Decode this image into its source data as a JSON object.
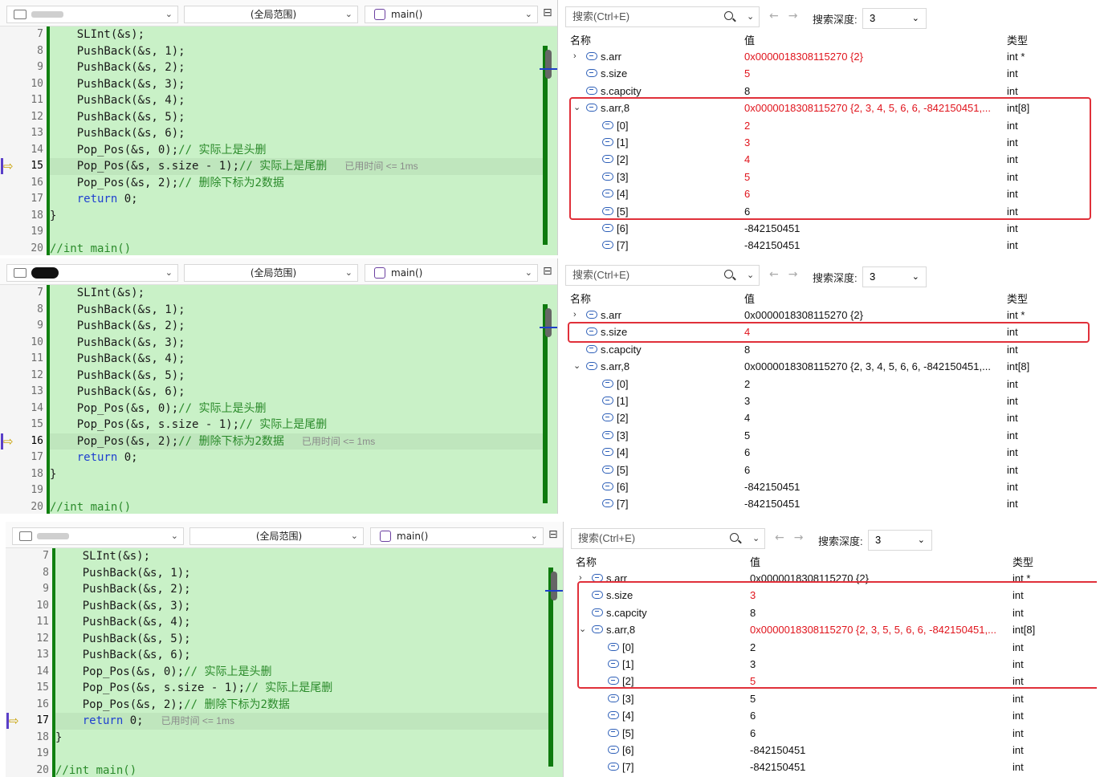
{
  "panels": [
    {
      "editor": {
        "project_selector": "",
        "scope_selector": "(全局范围)",
        "function_selector": "main()",
        "current_line": 15,
        "elapsed": "已用时间 <= 1ms",
        "lines": [
          {
            "num": "7",
            "code": "    SLInt(&s);"
          },
          {
            "num": "8",
            "code": "    PushBack(&s, 1);"
          },
          {
            "num": "9",
            "code": "    PushBack(&s, 2);"
          },
          {
            "num": "10",
            "code": "    PushBack(&s, 3);"
          },
          {
            "num": "11",
            "code": "    PushBack(&s, 4);"
          },
          {
            "num": "12",
            "code": "    PushBack(&s, 5);"
          },
          {
            "num": "13",
            "code": "    PushBack(&s, 6);"
          },
          {
            "num": "14",
            "code": "    Pop_Pos(&s, 0);",
            "comment": "// 实际上是头删"
          },
          {
            "num": "15",
            "code": "    Pop_Pos(&s, s.size - 1);",
            "comment": "// 实际上是尾删"
          },
          {
            "num": "16",
            "code": "    Pop_Pos(&s, 2);",
            "comment": "// 删除下标为2数据"
          },
          {
            "num": "17",
            "code": "    ",
            "keyword": "return",
            "after": " 0;"
          },
          {
            "num": "18",
            "code": "}"
          },
          {
            "num": "19",
            "code": ""
          },
          {
            "num": "20",
            "code": "",
            "comment": "//int main()"
          }
        ]
      },
      "watch": {
        "search_placeholder": "搜索(Ctrl+E)",
        "depth_label": "搜索深度:",
        "depth_value": "3",
        "col_name": "名称",
        "col_value": "值",
        "col_type": "类型",
        "rows": [
          {
            "name": "s.arr",
            "value": "0x0000018308115270 {2}",
            "type": "int *",
            "expander": "›",
            "indent": 0,
            "red": true
          },
          {
            "name": "s.size",
            "value": "5",
            "type": "int",
            "indent": 0,
            "red": true
          },
          {
            "name": "s.capcity",
            "value": "8",
            "type": "int",
            "indent": 0
          },
          {
            "name": "s.arr,8",
            "value": "0x0000018308115270 {2, 3, 4, 5, 6, 6, -842150451,...",
            "type": "int[8]",
            "expander": "⌄",
            "indent": 0,
            "red": true
          },
          {
            "name": "[0]",
            "value": "2",
            "type": "int",
            "indent": 1,
            "red": true
          },
          {
            "name": "[1]",
            "value": "3",
            "type": "int",
            "indent": 1,
            "red": true
          },
          {
            "name": "[2]",
            "value": "4",
            "type": "int",
            "indent": 1,
            "red": true
          },
          {
            "name": "[3]",
            "value": "5",
            "type": "int",
            "indent": 1,
            "red": true
          },
          {
            "name": "[4]",
            "value": "6",
            "type": "int",
            "indent": 1,
            "red": true
          },
          {
            "name": "[5]",
            "value": "6",
            "type": "int",
            "indent": 1
          },
          {
            "name": "[6]",
            "value": "-842150451",
            "type": "int",
            "indent": 1
          },
          {
            "name": "[7]",
            "value": "-842150451",
            "type": "int",
            "indent": 1
          }
        ]
      }
    },
    {
      "editor": {
        "project_selector": "",
        "scope_selector": "(全局范围)",
        "function_selector": "main()",
        "current_line": 16,
        "elapsed": "已用时间 <= 1ms",
        "lines": [
          {
            "num": "7",
            "code": "    SLInt(&s);"
          },
          {
            "num": "8",
            "code": "    PushBack(&s, 1);"
          },
          {
            "num": "9",
            "code": "    PushBack(&s, 2);"
          },
          {
            "num": "10",
            "code": "    PushBack(&s, 3);"
          },
          {
            "num": "11",
            "code": "    PushBack(&s, 4);"
          },
          {
            "num": "12",
            "code": "    PushBack(&s, 5);"
          },
          {
            "num": "13",
            "code": "    PushBack(&s, 6);"
          },
          {
            "num": "14",
            "code": "    Pop_Pos(&s, 0);",
            "comment": "// 实际上是头删"
          },
          {
            "num": "15",
            "code": "    Pop_Pos(&s, s.size - 1);",
            "comment": "// 实际上是尾删"
          },
          {
            "num": "16",
            "code": "    Pop_Pos(&s, 2);",
            "comment": "// 删除下标为2数据"
          },
          {
            "num": "17",
            "code": "    ",
            "keyword": "return",
            "after": " 0;"
          },
          {
            "num": "18",
            "code": "}"
          },
          {
            "num": "19",
            "code": ""
          },
          {
            "num": "20",
            "code": "",
            "comment": "//int main()"
          }
        ]
      },
      "watch": {
        "search_placeholder": "搜索(Ctrl+E)",
        "depth_label": "搜索深度:",
        "depth_value": "3",
        "col_name": "名称",
        "col_value": "值",
        "col_type": "类型",
        "rows": [
          {
            "name": "s.arr",
            "value": "0x0000018308115270 {2}",
            "type": "int *",
            "expander": "›",
            "indent": 0
          },
          {
            "name": "s.size",
            "value": "4",
            "type": "int",
            "indent": 0,
            "red": true
          },
          {
            "name": "s.capcity",
            "value": "8",
            "type": "int",
            "indent": 0
          },
          {
            "name": "s.arr,8",
            "value": "0x0000018308115270 {2, 3, 4, 5, 6, 6, -842150451,...",
            "type": "int[8]",
            "expander": "⌄",
            "indent": 0
          },
          {
            "name": "[0]",
            "value": "2",
            "type": "int",
            "indent": 1
          },
          {
            "name": "[1]",
            "value": "3",
            "type": "int",
            "indent": 1
          },
          {
            "name": "[2]",
            "value": "4",
            "type": "int",
            "indent": 1
          },
          {
            "name": "[3]",
            "value": "5",
            "type": "int",
            "indent": 1
          },
          {
            "name": "[4]",
            "value": "6",
            "type": "int",
            "indent": 1
          },
          {
            "name": "[5]",
            "value": "6",
            "type": "int",
            "indent": 1
          },
          {
            "name": "[6]",
            "value": "-842150451",
            "type": "int",
            "indent": 1
          },
          {
            "name": "[7]",
            "value": "-842150451",
            "type": "int",
            "indent": 1
          }
        ]
      }
    },
    {
      "editor": {
        "project_selector": "",
        "scope_selector": "(全局范围)",
        "function_selector": "main()",
        "current_line": 17,
        "elapsed": "已用时间 <= 1ms",
        "lines": [
          {
            "num": "7",
            "code": "    SLInt(&s);"
          },
          {
            "num": "8",
            "code": "    PushBack(&s, 1);"
          },
          {
            "num": "9",
            "code": "    PushBack(&s, 2);"
          },
          {
            "num": "10",
            "code": "    PushBack(&s, 3);"
          },
          {
            "num": "11",
            "code": "    PushBack(&s, 4);"
          },
          {
            "num": "12",
            "code": "    PushBack(&s, 5);"
          },
          {
            "num": "13",
            "code": "    PushBack(&s, 6);"
          },
          {
            "num": "14",
            "code": "    Pop_Pos(&s, 0);",
            "comment": "// 实际上是头删"
          },
          {
            "num": "15",
            "code": "    Pop_Pos(&s, s.size - 1);",
            "comment": "// 实际上是尾删"
          },
          {
            "num": "16",
            "code": "    Pop_Pos(&s, 2);",
            "comment": "// 删除下标为2数据"
          },
          {
            "num": "17",
            "code": "    ",
            "keyword": "return",
            "after": " 0;"
          },
          {
            "num": "18",
            "code": "}"
          },
          {
            "num": "19",
            "code": ""
          },
          {
            "num": "20",
            "code": "",
            "comment": "//int main()"
          }
        ]
      },
      "watch": {
        "search_placeholder": "搜索(Ctrl+E)",
        "depth_label": "搜索深度:",
        "depth_value": "3",
        "col_name": "名称",
        "col_value": "值",
        "col_type": "类型",
        "rows": [
          {
            "name": "s.arr",
            "value": "0x0000018308115270 {2}",
            "type": "int *",
            "expander": "›",
            "indent": 0
          },
          {
            "name": "s.size",
            "value": "3",
            "type": "int",
            "indent": 0,
            "red": true
          },
          {
            "name": "s.capcity",
            "value": "8",
            "type": "int",
            "indent": 0
          },
          {
            "name": "s.arr,8",
            "value": "0x0000018308115270 {2, 3, 5, 5, 6, 6, -842150451,...",
            "type": "int[8]",
            "expander": "⌄",
            "indent": 0,
            "red": true
          },
          {
            "name": "[0]",
            "value": "2",
            "type": "int",
            "indent": 1
          },
          {
            "name": "[1]",
            "value": "3",
            "type": "int",
            "indent": 1
          },
          {
            "name": "[2]",
            "value": "5",
            "type": "int",
            "indent": 1,
            "red": true
          },
          {
            "name": "[3]",
            "value": "5",
            "type": "int",
            "indent": 1
          },
          {
            "name": "[4]",
            "value": "6",
            "type": "int",
            "indent": 1
          },
          {
            "name": "[5]",
            "value": "6",
            "type": "int",
            "indent": 1
          },
          {
            "name": "[6]",
            "value": "-842150451",
            "type": "int",
            "indent": 1
          },
          {
            "name": "[7]",
            "value": "-842150451",
            "type": "int",
            "indent": 1
          }
        ]
      }
    }
  ]
}
